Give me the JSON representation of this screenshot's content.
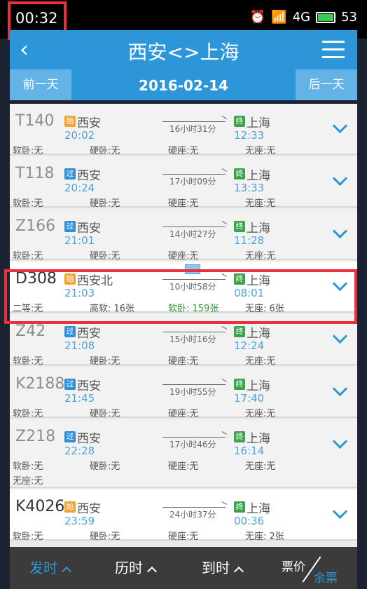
{
  "status": {
    "time": "00:32",
    "signal_label": "4G",
    "battery": "53"
  },
  "header": {
    "back_icon": "back-arrow-icon",
    "title": "西安<>上海",
    "menu_icon": "menu-icon"
  },
  "date_bar": {
    "prev": "前一天",
    "date": "2016-02-14",
    "next": "后一天"
  },
  "trains": [
    {
      "no": "T140",
      "from_badge": "始",
      "from": "西安",
      "dep": "20:02",
      "duration": "16小时31分",
      "to_badge": "终",
      "to": "上海",
      "arr": "12:33",
      "seats": [
        "软卧:无",
        "硬卧:无",
        "硬座:无",
        "无座:无"
      ]
    },
    {
      "no": "T118",
      "from_badge": "过",
      "from": "西安",
      "dep": "20:24",
      "duration": "17小时09分",
      "to_badge": "终",
      "to": "上海",
      "arr": "13:33",
      "seats": [
        "软卧:无",
        "硬卧:无",
        "硬座:无",
        "无座:无"
      ]
    },
    {
      "no": "Z166",
      "from_badge": "过",
      "from": "西安",
      "dep": "21:01",
      "duration": "14小时27分",
      "to_badge": "终",
      "to": "上海",
      "arr": "11:28",
      "seats": [
        "软卧:无",
        "硬卧:无",
        "硬座:无",
        "无座:无"
      ]
    },
    {
      "no": "D308",
      "from_badge": "始",
      "from": "西安北",
      "dep": "21:03",
      "duration": "10小时58分",
      "to_badge": "终",
      "to": "上海",
      "arr": "08:01",
      "seats": [
        "二等:无",
        "高软: 16张",
        "软卧: 159张",
        "无座: 6张"
      ]
    },
    {
      "no": "Z42",
      "from_badge": "过",
      "from": "西安",
      "dep": "21:08",
      "duration": "15小时16分",
      "to_badge": "终",
      "to": "上海",
      "arr": "12:24",
      "seats": [
        "软卧:无",
        "硬卧:无",
        "硬座:无",
        "无座:无"
      ]
    },
    {
      "no": "K2188",
      "from_badge": "过",
      "from": "西安",
      "dep": "21:45",
      "duration": "19小时55分",
      "to_badge": "终",
      "to": "上海",
      "arr": "17:40",
      "seats": [
        "软卧:无",
        "硬卧:无",
        "硬座:无",
        "无座:无"
      ]
    },
    {
      "no": "Z218",
      "from_badge": "过",
      "from": "西安",
      "dep": "22:28",
      "duration": "17小时46分",
      "to_badge": "终",
      "to": "上海",
      "arr": "16:14",
      "seats": [
        "软卧:无",
        "硬卧:无",
        "硬座:无",
        "无座:无"
      ],
      "extra": "无座:无"
    },
    {
      "no": "K4026",
      "from_badge": "始",
      "from": "西安",
      "dep": "23:59",
      "duration": "24小时37分",
      "to_badge": "终",
      "to": "上海",
      "arr": "00:36",
      "seats": [
        "软卧:无",
        "硬卧:无",
        "硬座:无",
        "无座: 2张"
      ]
    }
  ],
  "bottom": {
    "dep_sort": "发时",
    "dur_sort": "历时",
    "arr_sort": "到时",
    "price": "票价",
    "remaining": "余票"
  },
  "colors": {
    "primary": "#2d96d9",
    "start_badge": "#f3a234",
    "pass_badge": "#2f8fd9",
    "end_badge": "#3aa44a",
    "highlight": "#e8313a"
  }
}
